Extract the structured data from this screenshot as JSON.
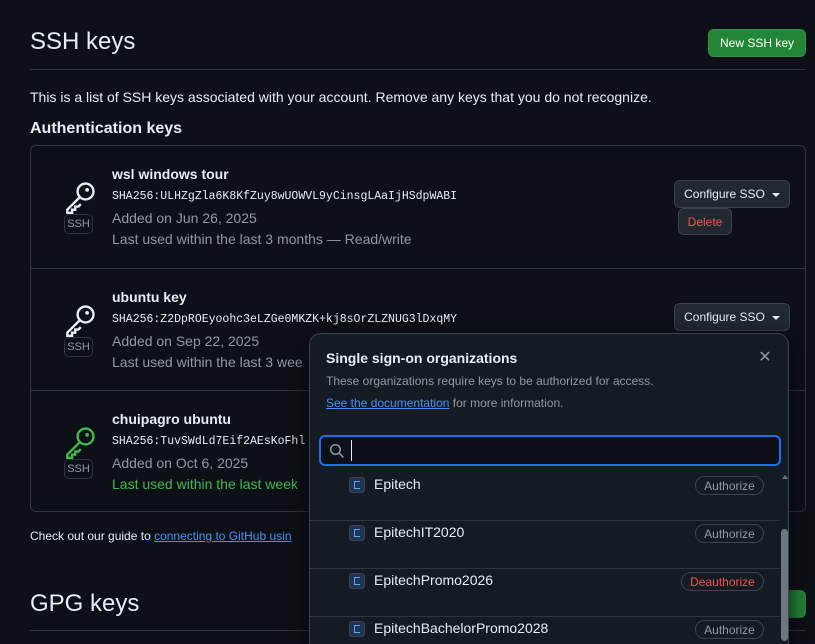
{
  "header": {
    "title": "SSH keys",
    "new_button": "New SSH key"
  },
  "intro": "This is a list of SSH keys associated with your account. Remove any keys that you do not recognize.",
  "auth_heading": "Authentication keys",
  "keys": [
    {
      "title": "wsl windows tour",
      "fingerprint": "SHA256:ULHZgZla6K8KfZuy8wUOWVL9yCinsgLAaIjHSdpWABI",
      "added": "Added on Jun 26, 2025",
      "last_used": "Last used within the last 3 months — Read/write",
      "badge": "SSH",
      "icon_color": "#e6edf3"
    },
    {
      "title": "ubuntu key",
      "fingerprint": "SHA256:Z2DpROEyoohc3eLZGe0MKZK+kj8sOrZLZNUG3lDxqMY",
      "added": "Added on Sep 22, 2025",
      "last_used": "Last used within the last 3 wee",
      "badge": "SSH",
      "icon_color": "#e6edf3"
    },
    {
      "title": "chuipagro ubuntu",
      "fingerprint": "SHA256:TuvSWdLd7Eif2AEsKoFhl",
      "added": "Added on Oct 6, 2025",
      "last_used": "Last used within the last week",
      "badge": "SSH",
      "icon_color": "#3fb950"
    }
  ],
  "buttons": {
    "configure_sso": "Configure SSO",
    "delete": "Delete"
  },
  "guide": {
    "prefix": "Check out our guide to ",
    "link": "connecting to GitHub usin"
  },
  "gpg": {
    "title": "GPG keys"
  },
  "sso_panel": {
    "title": "Single sign-on organizations",
    "description": "These organizations require keys to be authorized for access.",
    "doc_link": "See the documentation",
    "doc_suffix": " for more information.",
    "search_value": "",
    "orgs": [
      {
        "name": "Epitech",
        "action": "Authorize"
      },
      {
        "name": "EpitechIT2020",
        "action": "Authorize"
      },
      {
        "name": "EpitechPromo2026",
        "action": "Deauthorize"
      },
      {
        "name": "EpitechBachelorPromo2028",
        "action": "Authorize"
      }
    ]
  },
  "colors": {
    "accent_green": "#238636",
    "link_blue": "#4493f8",
    "danger_red": "#f85149",
    "active_green": "#3fb950"
  }
}
